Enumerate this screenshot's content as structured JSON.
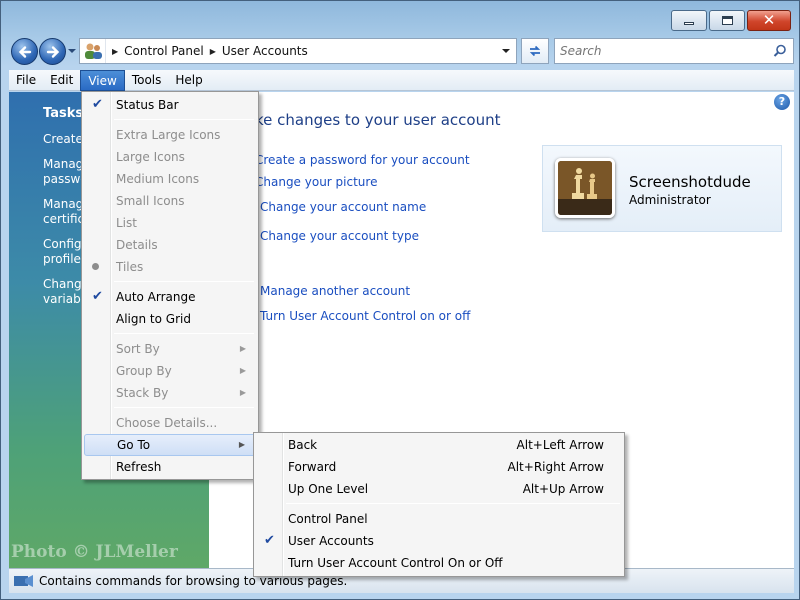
{
  "window": {
    "min_label": "minimize",
    "max_label": "maximize",
    "close_label": "close"
  },
  "address": {
    "crumbs": [
      "Control Panel",
      "User Accounts"
    ]
  },
  "search": {
    "placeholder": "Search"
  },
  "menubar": {
    "items": [
      "File",
      "Edit",
      "View",
      "Tools",
      "Help"
    ]
  },
  "tasks": {
    "heading": "Tasks",
    "links": [
      "Create",
      "Manag\npasswo",
      "Manag\ncertifica",
      "Configu\nprofile",
      "Change\nvariable"
    ]
  },
  "watermark": "Photo © JLMeller",
  "main": {
    "heading": "ke changes to your user account",
    "links": [
      "Create a password for your account",
      "Change your picture",
      "Change your account name",
      "Change your account type",
      "Manage another account",
      "Turn User Account Control on or off"
    ]
  },
  "user": {
    "name": "Screenshotdude",
    "role": "Administrator"
  },
  "view_menu": {
    "items": [
      {
        "label": "Status Bar",
        "checked": true
      },
      {
        "label": "Extra Large Icons",
        "disabled": true
      },
      {
        "label": "Large Icons",
        "disabled": true
      },
      {
        "label": "Medium Icons",
        "disabled": true
      },
      {
        "label": "Small Icons",
        "disabled": true
      },
      {
        "label": "List",
        "disabled": true
      },
      {
        "label": "Details",
        "disabled": true
      },
      {
        "label": "Tiles",
        "disabled": true,
        "bullet": true
      },
      {
        "label": "Auto Arrange",
        "checked": true
      },
      {
        "label": "Align to Grid"
      },
      {
        "label": "Sort By",
        "disabled": true,
        "submenu": true
      },
      {
        "label": "Group By",
        "disabled": true,
        "submenu": true
      },
      {
        "label": "Stack By",
        "disabled": true,
        "submenu": true
      },
      {
        "label": "Choose Details...",
        "disabled": true
      },
      {
        "label": "Go To",
        "submenu": true,
        "highlighted": true
      },
      {
        "label": "Refresh"
      }
    ]
  },
  "goto_menu": {
    "items": [
      {
        "label": "Back",
        "shortcut": "Alt+Left Arrow"
      },
      {
        "label": "Forward",
        "shortcut": "Alt+Right Arrow"
      },
      {
        "label": "Up One Level",
        "shortcut": "Alt+Up Arrow"
      },
      {
        "label": "Control Panel"
      },
      {
        "label": "User Accounts",
        "checked": true
      },
      {
        "label": "Turn User Account Control On or Off"
      }
    ]
  },
  "status": {
    "text": "Contains commands for browsing to various pages."
  },
  "colors": {
    "link": "#1a4ec0",
    "heading": "#1e3f87",
    "menu_highlight": "#cfdff6",
    "taskpane_top": "#2f6fae",
    "taskpane_bottom": "#5fa867"
  },
  "icons": {
    "back": "back-arrow-icon",
    "forward": "forward-arrow-icon",
    "refresh": "refresh-icon",
    "search": "search-icon",
    "help": "help-icon",
    "check": "checkmark-icon"
  }
}
